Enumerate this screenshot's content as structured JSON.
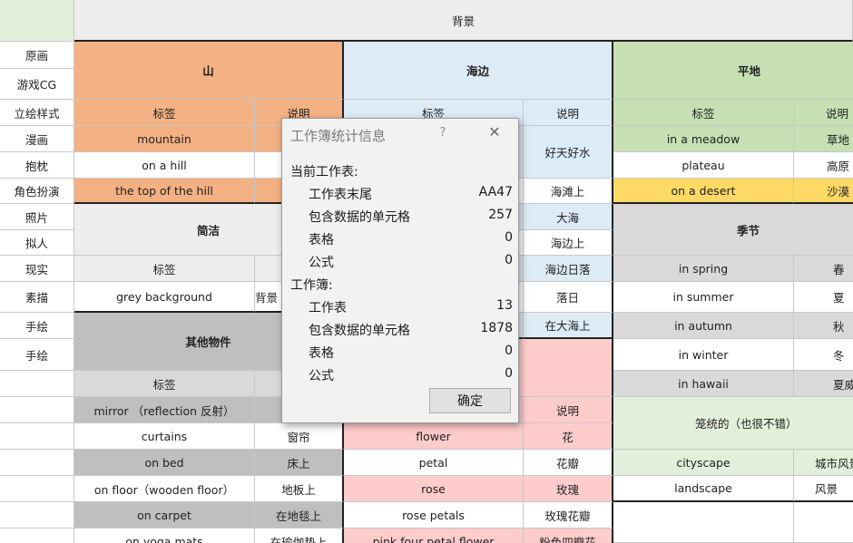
{
  "colors": {
    "orange": "#f4b183",
    "orange_light": "#f8cbad",
    "blue": "#ddebf7",
    "green": "#c6e0b4",
    "green_light": "#e2efda",
    "gray": "#d9d9d9",
    "gray_light": "#ededed",
    "gray_dark": "#bfbfbf",
    "pink": "#ffcccc",
    "yellow": "#ffd966",
    "white": "#ffffff"
  },
  "sheet": {
    "header_bg": "背景",
    "left_col": [
      "原画",
      "游戏CG",
      "立绘样式",
      "漫画",
      "抱枕",
      "角色扮演",
      "照片",
      "拟人",
      "现实",
      "素描",
      "手绘",
      "手绘"
    ],
    "mountain": {
      "title": "山",
      "head_tag": "标签",
      "head_desc": "说明",
      "rows": [
        [
          "mountain",
          ""
        ],
        [
          "on a hill",
          ""
        ],
        [
          "the top of the hill",
          ""
        ]
      ]
    },
    "simple": {
      "title": "简洁",
      "head_tag": "标签",
      "rows": [
        [
          "grey background",
          "背景"
        ]
      ]
    },
    "other": {
      "title": "其他物件",
      "head_tag": "标签",
      "rows": [
        [
          "mirror （reflection 反射）",
          ""
        ],
        [
          "curtains",
          "窗帘"
        ],
        [
          "on bed",
          "床上"
        ],
        [
          "on floor（wooden floor）",
          "地板上"
        ],
        [
          "on carpet",
          "在地毯上"
        ],
        [
          "on yoga mats",
          "在瑜伽垫上"
        ]
      ]
    },
    "seaside": {
      "title": "海边",
      "head_tag": "标签",
      "head_desc": "说明",
      "desc": [
        "好天好水",
        "海滩上",
        "大海",
        "海边上",
        "海边日落",
        "落日",
        "在大海上"
      ]
    },
    "flower": {
      "head_desc": "说明",
      "rows": [
        [
          "flower",
          "花"
        ],
        [
          "petal",
          "花瓣"
        ],
        [
          "rose",
          "玫瑰"
        ],
        [
          "rose petals",
          "玫瑰花瓣"
        ],
        [
          "pink four petal flower",
          "粉色四瓣花"
        ]
      ]
    },
    "plain": {
      "title": "平地",
      "head_tag": "标签",
      "head_desc": "说明",
      "rows": [
        [
          "in a meadow",
          "草地"
        ],
        [
          "plateau",
          "高原"
        ],
        [
          "on a desert",
          "沙漠"
        ]
      ]
    },
    "season": {
      "title": "季节",
      "rows": [
        [
          "in spring",
          "春"
        ],
        [
          "in summer",
          "夏"
        ],
        [
          "in autumn",
          "秋"
        ],
        [
          "in winter",
          "冬"
        ],
        [
          "in hawaii",
          "夏威夷"
        ]
      ]
    },
    "city": {
      "title": "笼统的（也很不错）",
      "rows": [
        [
          "cityscape",
          "城市风景"
        ],
        [
          "landscape",
          "风景"
        ]
      ]
    }
  },
  "dialog": {
    "title": "工作簿统计信息",
    "help": "?",
    "close": "✕",
    "current_sheet_label": "当前工作表:",
    "sheet_end_label": "工作表末尾",
    "sheet_end_value": "AA47",
    "cells_label": "包含数据的单元格",
    "cells_value": "257",
    "tables_label": "表格",
    "tables_value": "0",
    "formulas_label": "公式",
    "formulas_value": "0",
    "workbook_label": "工作簿:",
    "wb_sheets_label": "工作表",
    "wb_sheets_value": "13",
    "wb_cells_label": "包含数据的单元格",
    "wb_cells_value": "1878",
    "wb_tables_label": "表格",
    "wb_tables_value": "0",
    "wb_formulas_label": "公式",
    "wb_formulas_value": "0",
    "ok_label": "确定"
  }
}
